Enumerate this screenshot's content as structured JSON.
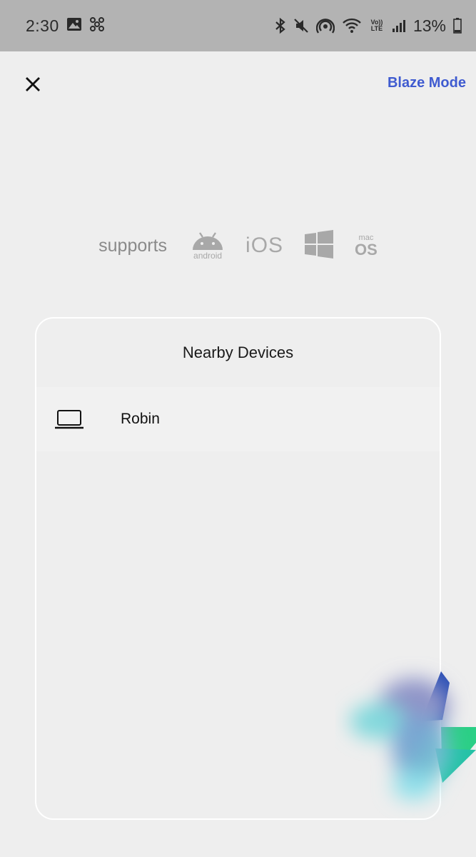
{
  "status_bar": {
    "time": "2:30",
    "battery": "13%",
    "icons_left": [
      "image-icon",
      "fan-icon"
    ],
    "icons_right": [
      "bluetooth-icon",
      "mute-icon",
      "hotspot-icon",
      "wifi-icon",
      "volte-icon",
      "signal-icon",
      "battery-icon"
    ],
    "volte_label": "Vo)) LTE"
  },
  "header": {
    "close_icon": "close-icon",
    "blaze_mode": "Blaze Mode",
    "accent_color": "#3f5bd0"
  },
  "supports": {
    "label": "supports",
    "android": "android",
    "ios": "iOS",
    "windows_icon": "windows-icon",
    "mac_top": "mac",
    "mac_bottom": "OS"
  },
  "nearby": {
    "title": "Nearby Devices",
    "devices": [
      {
        "name": "Robin",
        "icon": "laptop-icon"
      }
    ]
  }
}
